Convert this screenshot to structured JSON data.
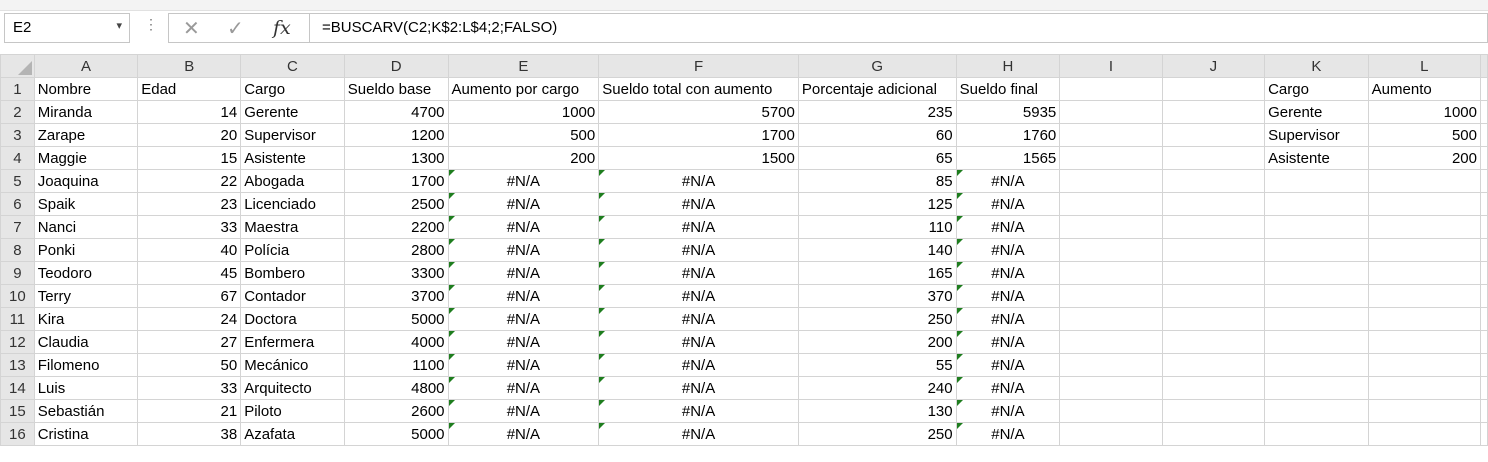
{
  "namebox": {
    "value": "E2"
  },
  "formula": {
    "value": "=BUSCARV(C2;K$2:L$4;2;FALSO)"
  },
  "icons": {
    "cancel": "✕",
    "enter": "✓",
    "fx": "fx",
    "dropdown": "▾",
    "dots": "⋮"
  },
  "columns": [
    "A",
    "B",
    "C",
    "D",
    "E",
    "F",
    "G",
    "H",
    "I",
    "J",
    "K",
    "L"
  ],
  "row_numbers": [
    "1",
    "2",
    "3",
    "4",
    "5",
    "6",
    "7",
    "8",
    "9",
    "10",
    "11",
    "12",
    "13",
    "14",
    "15",
    "16"
  ],
  "rows": [
    [
      "Nombre",
      "Edad",
      "Cargo",
      "Sueldo base",
      "Aumento por cargo",
      "Sueldo total con aumento",
      "Porcentaje adicional",
      "Sueldo final",
      "",
      "",
      "Cargo",
      "Aumento"
    ],
    [
      "Miranda",
      "14",
      "Gerente",
      "4700",
      "1000",
      "5700",
      "235",
      "5935",
      "",
      "",
      "Gerente",
      "1000"
    ],
    [
      "Zarape",
      "20",
      "Supervisor",
      "1200",
      "500",
      "1700",
      "60",
      "1760",
      "",
      "",
      "Supervisor",
      "500"
    ],
    [
      "Maggie",
      "15",
      "Asistente",
      "1300",
      "200",
      "1500",
      "65",
      "1565",
      "",
      "",
      "Asistente",
      "200"
    ],
    [
      "Joaquina",
      "22",
      "Abogada",
      "1700",
      "#N/A",
      "#N/A",
      "85",
      "#N/A",
      "",
      "",
      "",
      ""
    ],
    [
      "Spaik",
      "23",
      "Licenciado",
      "2500",
      "#N/A",
      "#N/A",
      "125",
      "#N/A",
      "",
      "",
      "",
      ""
    ],
    [
      "Nanci",
      "33",
      "Maestra",
      "2200",
      "#N/A",
      "#N/A",
      "110",
      "#N/A",
      "",
      "",
      "",
      ""
    ],
    [
      "Ponki",
      "40",
      "Polícia",
      "2800",
      "#N/A",
      "#N/A",
      "140",
      "#N/A",
      "",
      "",
      "",
      ""
    ],
    [
      "Teodoro",
      "45",
      "Bombero",
      "3300",
      "#N/A",
      "#N/A",
      "165",
      "#N/A",
      "",
      "",
      "",
      ""
    ],
    [
      "Terry",
      "67",
      "Contador",
      "3700",
      "#N/A",
      "#N/A",
      "370",
      "#N/A",
      "",
      "",
      "",
      ""
    ],
    [
      "Kira",
      "24",
      "Doctora",
      "5000",
      "#N/A",
      "#N/A",
      "250",
      "#N/A",
      "",
      "",
      "",
      ""
    ],
    [
      "Claudia",
      "27",
      "Enfermera",
      "4000",
      "#N/A",
      "#N/A",
      "200",
      "#N/A",
      "",
      "",
      "",
      ""
    ],
    [
      "Filomeno",
      "50",
      "Mecánico",
      "1100",
      "#N/A",
      "#N/A",
      "55",
      "#N/A",
      "",
      "",
      "",
      ""
    ],
    [
      "Luis",
      "33",
      "Arquitecto",
      "4800",
      "#N/A",
      "#N/A",
      "240",
      "#N/A",
      "",
      "",
      "",
      ""
    ],
    [
      "Sebastián",
      "21",
      "Piloto",
      "2600",
      "#N/A",
      "#N/A",
      "130",
      "#N/A",
      "",
      "",
      "",
      ""
    ],
    [
      "Cristina",
      "38",
      "Azafata",
      "5000",
      "#N/A",
      "#N/A",
      "250",
      "#N/A",
      "",
      "",
      "",
      ""
    ]
  ],
  "colors": {
    "error_flag": "#1e7d1e",
    "header_bg": "#e6e6e6",
    "grid": "#d4d4d4"
  }
}
